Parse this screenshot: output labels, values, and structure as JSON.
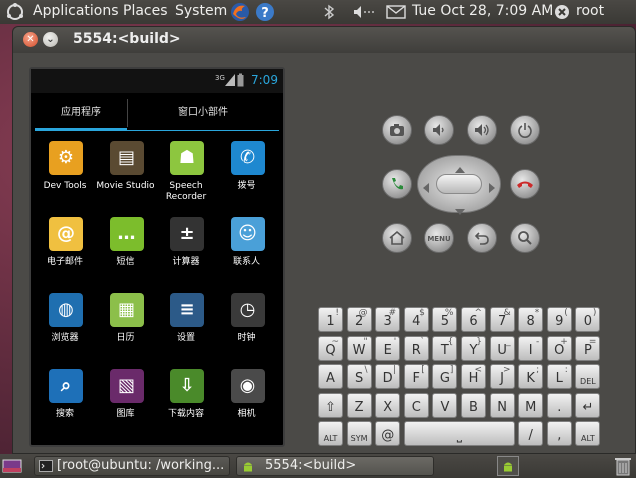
{
  "top_panel": {
    "menus": [
      "Applications",
      "Places",
      "System"
    ],
    "clock": "Tue Oct 28,  7:09 AM",
    "user": "root"
  },
  "window": {
    "title": "5554:<build>"
  },
  "phone": {
    "statusbar": {
      "network": "3G",
      "time": "7:09"
    },
    "tabs": [
      {
        "label": "应用程序"
      },
      {
        "label": "窗口小部件"
      }
    ],
    "apps": [
      {
        "label": "Dev Tools",
        "icon": "gear-icon",
        "color": "#e8a020"
      },
      {
        "label": "Movie Studio",
        "icon": "clapperboard-icon",
        "color": "#5a4a32"
      },
      {
        "label": "Speech Recorder",
        "icon": "android-icon",
        "color": "#8dc63f"
      },
      {
        "label": "拨号",
        "icon": "phone-icon",
        "color": "#1e88d0"
      },
      {
        "label": "电子邮件",
        "icon": "email-icon",
        "color": "#f0c040"
      },
      {
        "label": "短信",
        "icon": "message-icon",
        "color": "#7cbd2c"
      },
      {
        "label": "计算器",
        "icon": "calculator-icon",
        "color": "#333333"
      },
      {
        "label": "联系人",
        "icon": "contacts-icon",
        "color": "#4aa0d8"
      },
      {
        "label": "浏览器",
        "icon": "globe-icon",
        "color": "#1f6fb0"
      },
      {
        "label": "日历",
        "icon": "calendar-icon",
        "color": "#8cbf4a"
      },
      {
        "label": "设置",
        "icon": "settings-icon",
        "color": "#2c5a88"
      },
      {
        "label": "时钟",
        "icon": "clock-icon",
        "color": "#3a3a3a"
      },
      {
        "label": "搜索",
        "icon": "search-icon",
        "color": "#1e70b8"
      },
      {
        "label": "图库",
        "icon": "gallery-icon",
        "color": "#6a2a6a"
      },
      {
        "label": "下载内容",
        "icon": "download-icon",
        "color": "#4a8a2a"
      },
      {
        "label": "相机",
        "icon": "camera-icon",
        "color": "#4a4a4a"
      }
    ]
  },
  "controls": {
    "menu_label": "MENU"
  },
  "keyboard": {
    "rows": [
      [
        {
          "main": "1",
          "alt": "!"
        },
        {
          "main": "2",
          "alt": "@"
        },
        {
          "main": "3",
          "alt": "#"
        },
        {
          "main": "4",
          "alt": "$"
        },
        {
          "main": "5",
          "alt": "%"
        },
        {
          "main": "6",
          "alt": "^"
        },
        {
          "main": "7",
          "alt": "&"
        },
        {
          "main": "8",
          "alt": "*"
        },
        {
          "main": "9",
          "alt": "("
        },
        {
          "main": "0",
          "alt": ")"
        }
      ],
      [
        {
          "main": "Q",
          "alt": "~"
        },
        {
          "main": "W",
          "alt": "\""
        },
        {
          "main": "E",
          "alt": "'"
        },
        {
          "main": "R",
          "alt": "`"
        },
        {
          "main": "T",
          "alt": "{"
        },
        {
          "main": "Y",
          "alt": "}"
        },
        {
          "main": "U",
          "alt": "_"
        },
        {
          "main": "I",
          "alt": "-"
        },
        {
          "main": "O",
          "alt": "+"
        },
        {
          "main": "P",
          "alt": "="
        }
      ],
      [
        {
          "main": "A",
          "alt": ""
        },
        {
          "main": "S",
          "alt": "\\"
        },
        {
          "main": "D",
          "alt": "|"
        },
        {
          "main": "F",
          "alt": "["
        },
        {
          "main": "G",
          "alt": "]"
        },
        {
          "main": "H",
          "alt": "<"
        },
        {
          "main": "J",
          "alt": ">"
        },
        {
          "main": "K",
          "alt": ";"
        },
        {
          "main": "L",
          "alt": ":"
        },
        {
          "main": "DEL",
          "alt": ""
        }
      ],
      [
        {
          "main": "⇧",
          "alt": ""
        },
        {
          "main": "Z",
          "alt": ""
        },
        {
          "main": "X",
          "alt": ""
        },
        {
          "main": "C",
          "alt": ""
        },
        {
          "main": "V",
          "alt": ""
        },
        {
          "main": "B",
          "alt": ""
        },
        {
          "main": "N",
          "alt": ""
        },
        {
          "main": "M",
          "alt": ""
        },
        {
          "main": ".",
          "alt": ""
        },
        {
          "main": "↵",
          "alt": ""
        }
      ],
      [
        {
          "main": "ALT",
          "alt": ""
        },
        {
          "main": "SYM",
          "alt": ""
        },
        {
          "main": "@",
          "alt": ""
        },
        {
          "main": "⎵",
          "alt": ""
        },
        {
          "main": "/",
          "alt": ""
        },
        {
          "main": ",",
          "alt": ""
        },
        {
          "main": "ALT",
          "alt": ""
        }
      ]
    ]
  },
  "bottom_panel": {
    "tasks": [
      {
        "label": "[root@ubuntu: /working..."
      },
      {
        "label": "5554:<build>"
      }
    ]
  }
}
